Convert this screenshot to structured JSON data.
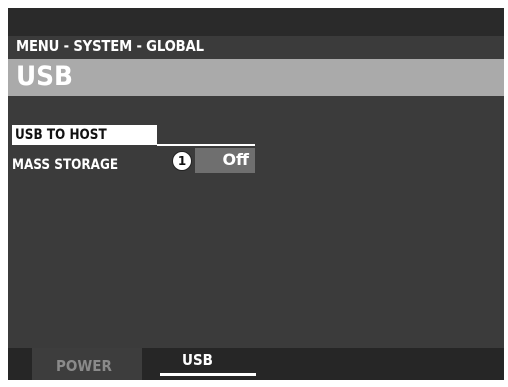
{
  "header": {
    "breadcrumb": "MENU - SYSTEM - GLOBAL",
    "title": "USB"
  },
  "rows": [
    {
      "label": "USB TO HOST",
      "selected": true
    },
    {
      "label": "MASS STORAGE",
      "callout": "1",
      "value": "Off"
    }
  ],
  "tabs": [
    {
      "label": "POWER",
      "active": false
    },
    {
      "label": "USB",
      "active": true
    }
  ],
  "colors": {
    "screen_bg": "#3b3b3b",
    "title_bar": "#aaaaaa",
    "value_box": "#6f6f6f",
    "tab_bar": "#262626",
    "text": "#ffffff"
  }
}
